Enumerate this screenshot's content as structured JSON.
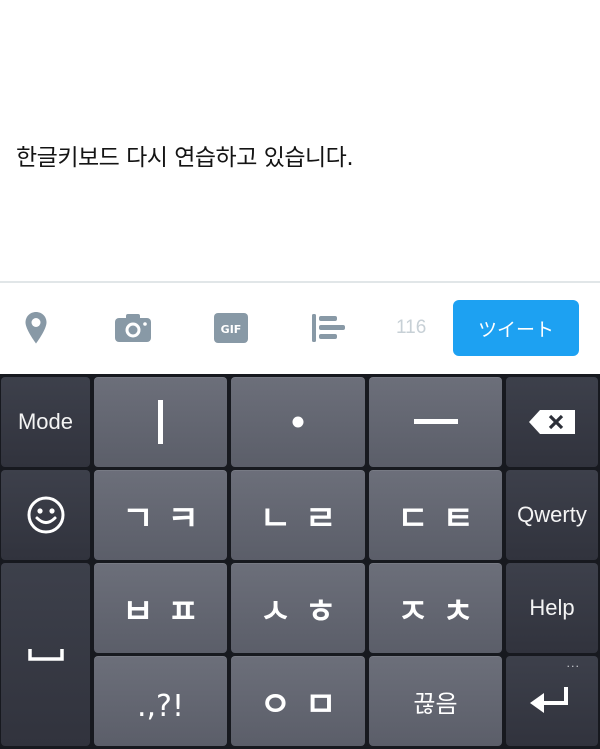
{
  "compose": {
    "text": "한글키보드 다시 연습하고 있습니다."
  },
  "toolbar": {
    "icons": [
      "location-pin-icon",
      "camera-icon",
      "gif-icon",
      "poll-icon"
    ],
    "gif_label": "GIF",
    "char_count": "116",
    "tweet_button": "ツイート",
    "accent_color": "#1da1f2"
  },
  "keyboard": {
    "side_left": {
      "mode": "Mode",
      "emoji": "emoji-icon",
      "space": "space-icon"
    },
    "side_right": {
      "backspace": "backspace-icon",
      "qwerty": "Qwerty",
      "help": "Help",
      "more": "···",
      "enter": "enter-icon"
    },
    "rows": [
      [
        "ㅣ",
        "·",
        "ㅡ"
      ],
      [
        "ㄱㅋ",
        "ㄴㄹ",
        "ㄷㅌ"
      ],
      [
        "ㅂㅍ",
        "ㅅㅎ",
        "ㅈㅊ"
      ],
      [
        ".,?!",
        "ㅇㅁ",
        "끊음"
      ]
    ]
  }
}
